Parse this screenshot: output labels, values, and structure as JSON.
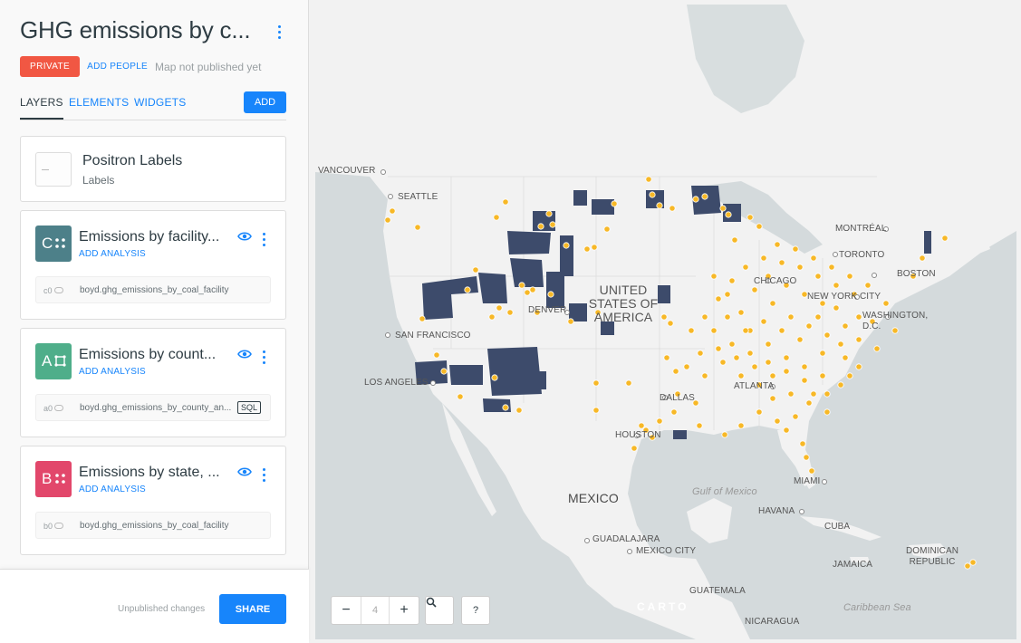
{
  "sidebar": {
    "title": "GHG emissions by c...",
    "privacy_badge": "PRIVATE",
    "add_people": "ADD PEOPLE",
    "publish_status": "Map not published yet",
    "tabs": [
      {
        "label": "LAYERS",
        "active": true
      },
      {
        "label": "ELEMENTS",
        "active": false
      },
      {
        "label": "WIDGETS",
        "active": false
      }
    ],
    "add_button": "ADD",
    "basemap": {
      "title": "Positron Labels",
      "subtitle": "Labels"
    },
    "layers": [
      {
        "letter": "C",
        "color": "#4d8089",
        "icon": "points-icon",
        "title": "Emissions by facility...",
        "add_analysis": "ADD ANALYSIS",
        "source_id": "c0",
        "source_name": "boyd.ghg_emissions_by_coal_facility",
        "sql": ""
      },
      {
        "letter": "A",
        "color": "#4fae8a",
        "icon": "polygon-icon",
        "title": "Emissions by count...",
        "add_analysis": "ADD ANALYSIS",
        "source_id": "a0",
        "source_name": "boyd.ghg_emissions_by_county_an...",
        "sql": "SQL"
      },
      {
        "letter": "B",
        "color": "#e2476b",
        "icon": "points-icon",
        "title": "Emissions by state, ...",
        "add_analysis": "ADD ANALYSIS",
        "source_id": "b0",
        "source_name": "boyd.ghg_emissions_by_coal_facility",
        "sql": ""
      }
    ],
    "footer": {
      "status": "Unpublished changes",
      "share_button": "SHARE"
    }
  },
  "map": {
    "zoom_level": "4",
    "zoom_out": "−",
    "zoom_in": "+",
    "help": "?",
    "attribution_logo": "CARTO",
    "labels": {
      "vancouver": "VANCOUVER",
      "seattle": "SEATTLE",
      "montreal": "MONTRÉAL",
      "toronto": "TORONTO",
      "boston": "BOSTON",
      "chicago": "CHICAGO",
      "new_york": "NEW YORK CITY",
      "washington": "WASHINGTON, D.C.",
      "denver": "DENVER",
      "usa": "UNITED STATES OF AMERICA",
      "san_francisco": "SAN FRANCISCO",
      "los_angeles": "LOS ANGELES",
      "dallas": "DALLAS",
      "atlanta": "ATLANTA",
      "houston": "HOUSTON",
      "miami": "MIAMI",
      "mexico": "MEXICO",
      "gulf": "Gulf of Mexico",
      "havana": "HAVANA",
      "cuba": "CUBA",
      "guadalajara": "GUADALAJARA",
      "mexico_city": "MEXICO CITY",
      "dominican_republic": "DOMINICAN REPUBLIC",
      "jamaica": "JAMAICA",
      "guatemala": "GUATEMALA",
      "caribbean": "Caribbean Sea",
      "nicaragua": "NICARAGUA"
    },
    "colors": {
      "water": "#d4dadc",
      "land": "#f2f2f2",
      "county_fill": "#3d4b6b",
      "facility_point": "#f7b827"
    }
  }
}
